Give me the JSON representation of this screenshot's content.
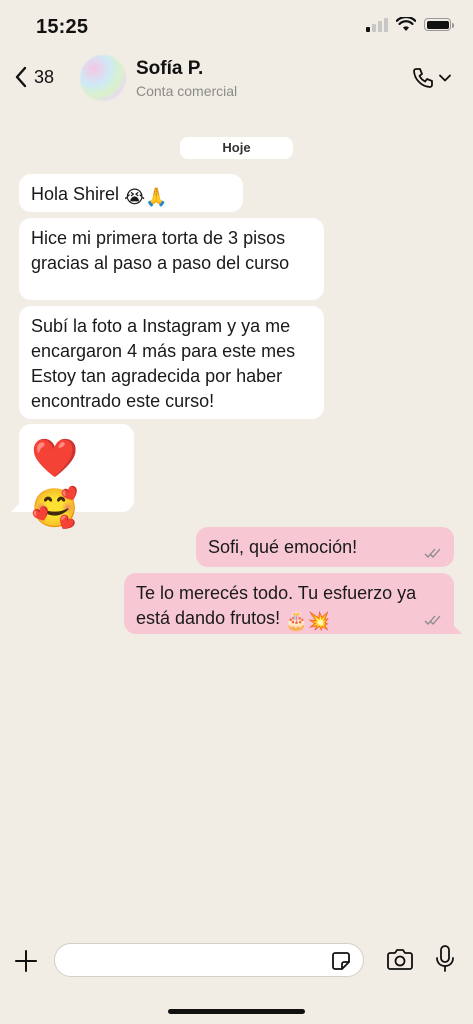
{
  "status_bar": {
    "time": "15:25"
  },
  "header": {
    "back_count": "38",
    "contact_name": "Sofía P.",
    "contact_subtitle": "Conta comercial"
  },
  "chat": {
    "date_label": "Hoje",
    "messages": [
      {
        "direction": "in",
        "text": "Hola Shirel",
        "emojis": "😭🙏"
      },
      {
        "direction": "in",
        "text": "Hice mi primera torta de 3 pisos\ngracias al paso a paso del curso"
      },
      {
        "direction": "in",
        "text": "Subí la foto a Instagram y ya me\nencargaron 4 más para este mes\nEstoy tan agradecida por haber\nencontrado este curso!"
      },
      {
        "direction": "in",
        "emojis": "❤️🥰"
      },
      {
        "direction": "out",
        "text": "Sofi, qué emoción!"
      },
      {
        "direction": "out",
        "text": "Te lo merecés todo. Tu esfuerzo ya\nestá dando frutos!",
        "emojis": "🎂💥"
      }
    ]
  },
  "composer": {
    "placeholder": ""
  },
  "colors": {
    "background": "#f1ede4",
    "incoming_bubble": "#ffffff",
    "outgoing_bubble": "#f7c7d4",
    "tick": "#8a8a8a"
  },
  "icons": [
    "back-chevron-icon",
    "phone-icon",
    "chevron-down-icon",
    "plus-icon",
    "sticker-icon",
    "camera-icon",
    "microphone-icon",
    "double-check-icon",
    "wifi-icon",
    "battery-icon",
    "signal-icon"
  ]
}
